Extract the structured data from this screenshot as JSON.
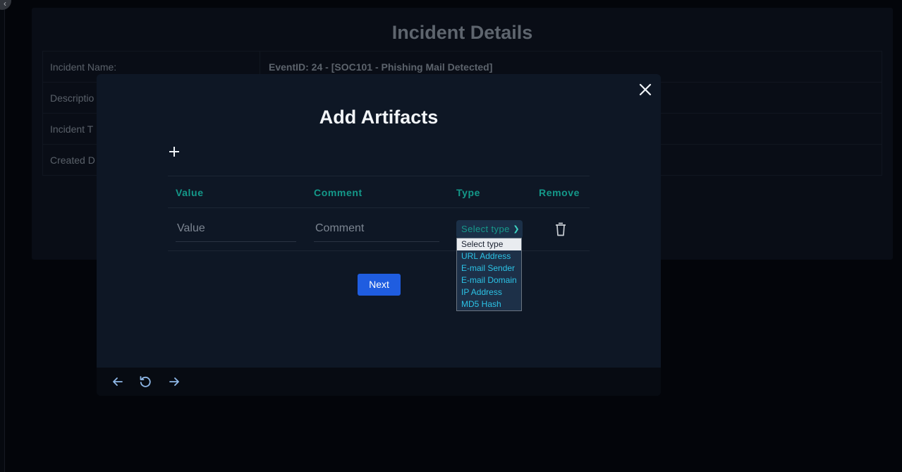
{
  "background": {
    "title": "Incident Details",
    "rows": [
      {
        "key": "Incident Name:",
        "value": "EventID: 24 - [SOC101 - Phishing Mail Detected]"
      },
      {
        "key": "Descriptio",
        "value": ""
      },
      {
        "key": "Incident T",
        "value": ""
      },
      {
        "key": "Created D",
        "value": ""
      }
    ]
  },
  "modal": {
    "title": "Add Artifacts",
    "columns": {
      "value": "Value",
      "comment": "Comment",
      "type": "Type",
      "remove": "Remove"
    },
    "row": {
      "value_placeholder": "Value",
      "comment_placeholder": "Comment",
      "type_selected": "Select type"
    },
    "type_options": [
      "Select type",
      "URL Address",
      "E-mail Sender",
      "E-mail Domain",
      "IP Address",
      "MD5 Hash"
    ],
    "next_label": "Next"
  },
  "colors": {
    "accent_teal": "#14998a",
    "primary_button": "#1f5de0",
    "modal_bg": "#0e1725"
  },
  "icons": {
    "close": "close-icon",
    "add": "plus-icon",
    "remove": "trash-icon",
    "back": "arrow-left-icon",
    "reload": "reload-icon",
    "forward": "arrow-right-icon"
  }
}
